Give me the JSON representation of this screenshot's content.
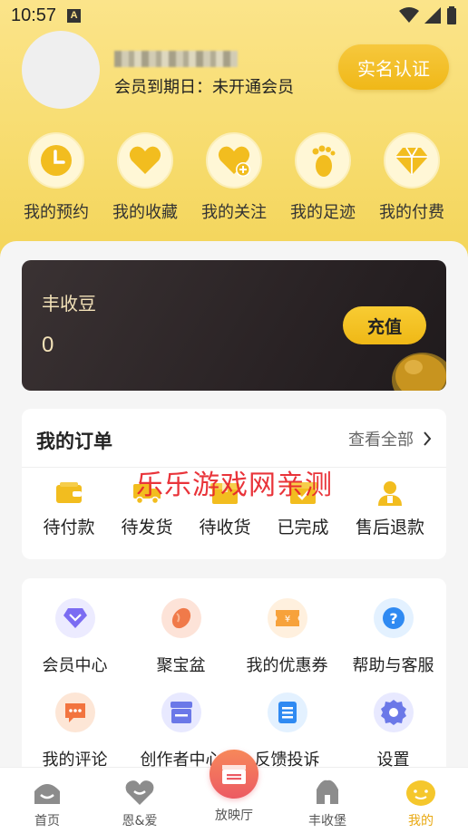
{
  "status_bar": {
    "time": "10:57",
    "badge": "A"
  },
  "profile": {
    "member_expiry": "会员到期日：未开通会员",
    "verify_button": "实名认证"
  },
  "quick_links": [
    {
      "label": "我的预约",
      "icon": "clock-icon"
    },
    {
      "label": "我的收藏",
      "icon": "heart-icon"
    },
    {
      "label": "我的关注",
      "icon": "heart-plus-icon"
    },
    {
      "label": "我的足迹",
      "icon": "footprint-icon"
    },
    {
      "label": "我的付费",
      "icon": "diamond-icon"
    }
  ],
  "bean_card": {
    "title": "丰收豆",
    "value": "0",
    "recharge_label": "充值"
  },
  "orders": {
    "title": "我的订单",
    "view_all": "查看全部",
    "items": [
      {
        "label": "待付款",
        "icon": "wallet-icon"
      },
      {
        "label": "待发货",
        "icon": "truck-icon"
      },
      {
        "label": "待收货",
        "icon": "package-icon"
      },
      {
        "label": "已完成",
        "icon": "box-check-icon"
      },
      {
        "label": "售后退款",
        "icon": "service-person-icon"
      }
    ]
  },
  "watermark": "乐乐游戏网亲测",
  "services": [
    {
      "label": "会员中心",
      "icon": "vip-diamond-icon"
    },
    {
      "label": "聚宝盆",
      "icon": "bean-icon"
    },
    {
      "label": "我的优惠券",
      "icon": "coupon-icon"
    },
    {
      "label": "帮助与客服",
      "icon": "help-icon"
    },
    {
      "label": "我的评论",
      "icon": "comment-icon"
    },
    {
      "label": "创作者中心",
      "icon": "store-icon"
    },
    {
      "label": "反馈投诉",
      "icon": "feedback-icon"
    },
    {
      "label": "设置",
      "icon": "settings-icon"
    }
  ],
  "tabbar": [
    {
      "label": "首页",
      "icon": "home-icon"
    },
    {
      "label": "恩&爱",
      "icon": "love-icon"
    },
    {
      "label": "放映厅",
      "icon": "cinema-icon"
    },
    {
      "label": "丰收堡",
      "icon": "castle-icon"
    },
    {
      "label": "我的",
      "icon": "me-icon"
    }
  ],
  "colors": {
    "brand_yellow": "#f2bd1f",
    "hero_bg": "#f7dc6e",
    "card_dark": "#2a2325",
    "watermark_red": "#e8232a",
    "active_tab": "#e9a913"
  }
}
